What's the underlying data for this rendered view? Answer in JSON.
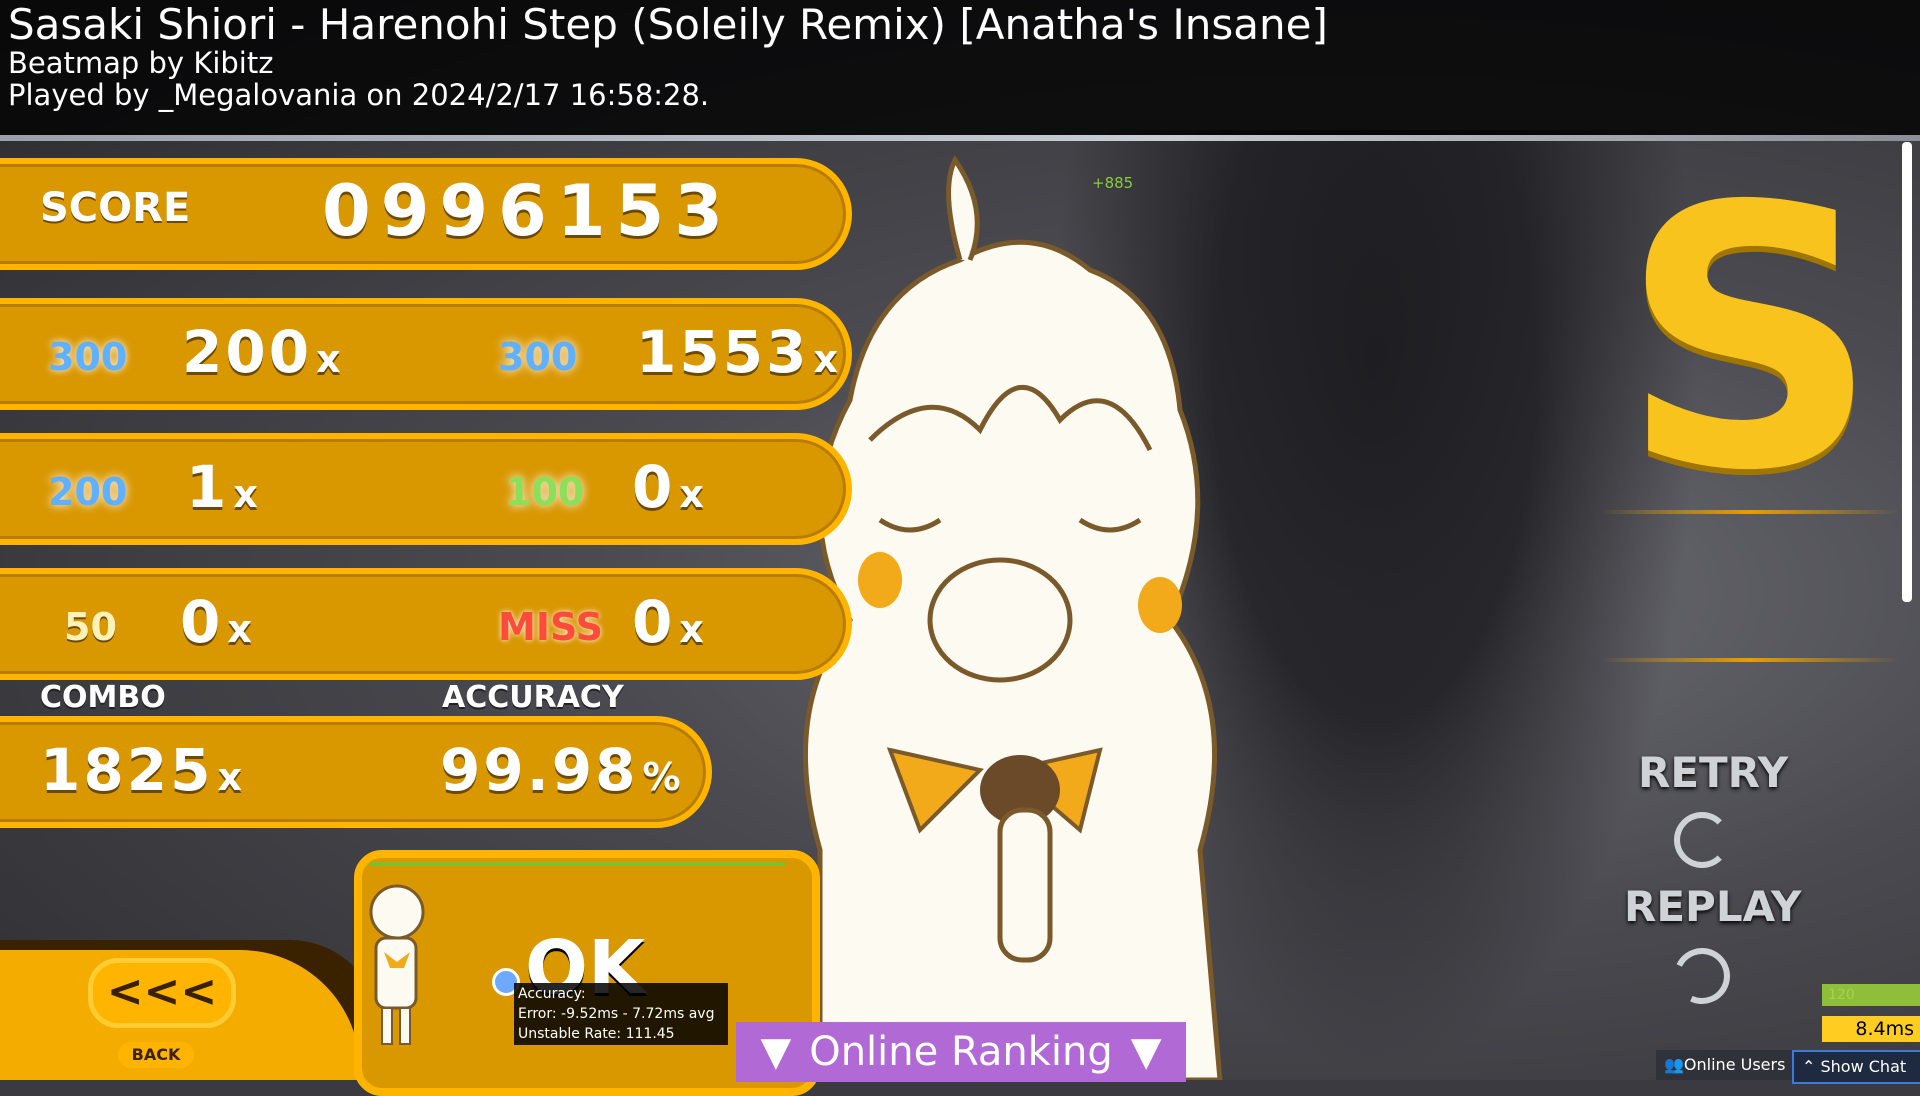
{
  "header": {
    "title": "Sasaki Shiori - Harenohi Step (Soleily Remix) [Anatha's Insane]",
    "mapper": "Beatmap by Kibitz",
    "played_by": "Played by _Megalovania on 2024/2/17 16:58:28."
  },
  "score": {
    "label": "SCORE",
    "value": "0996153",
    "gain": "+885"
  },
  "hits": {
    "h300": {
      "icon": "300",
      "count": "200"
    },
    "geki": {
      "icon": "300",
      "count": "1553"
    },
    "h100": {
      "icon": "200",
      "count": "1"
    },
    "katu": {
      "icon": "100",
      "count": "0"
    },
    "h50": {
      "icon": "50",
      "count": "0"
    },
    "miss": {
      "icon": "MISS",
      "count": "0"
    },
    "x_suffix": "x"
  },
  "combo": {
    "label": "COMBO",
    "value": "1825",
    "suffix": "x"
  },
  "accuracy": {
    "label": "ACCURACY",
    "value": "99.98",
    "suffix": "%"
  },
  "grade": "S",
  "buttons": {
    "retry": "RETRY",
    "replay": "REPLAY",
    "back_arrow": "<<<",
    "back": "BACK"
  },
  "graph": {
    "status": "OK",
    "tooltip": {
      "line1": "Accuracy:",
      "line2": "Error: -9.52ms - 7.72ms avg",
      "line3": "Unstable Rate: 111.45"
    }
  },
  "ranking": {
    "label": "Online Ranking",
    "arrow": "▼"
  },
  "meters": {
    "fps": "120",
    "latency": "8.4ms"
  },
  "footer": {
    "online_users": "Online Users",
    "show_chat": "Show Chat"
  },
  "colors": {
    "panel": "#d99700",
    "panel_border": "#ffb400",
    "grade": "#f7c31c",
    "ranking": "#b169d6"
  }
}
